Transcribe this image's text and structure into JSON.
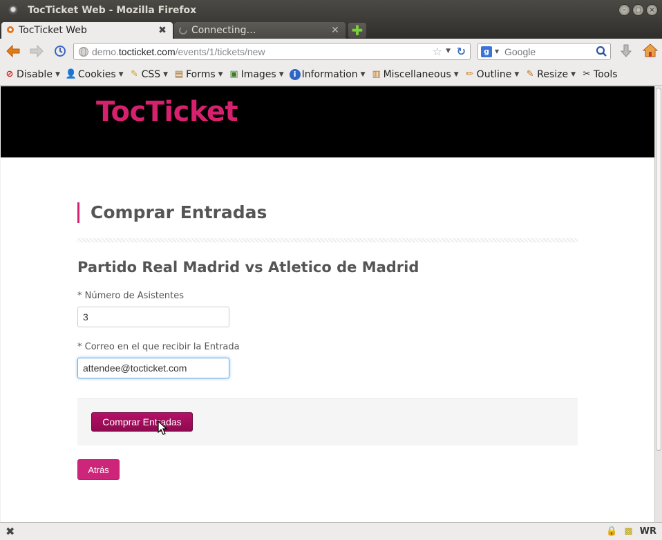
{
  "window": {
    "title": "TocTicket Web - Mozilla Firefox"
  },
  "tabs": [
    {
      "label": "TocTicket Web",
      "active": true
    },
    {
      "label": "Connecting…",
      "active": false
    }
  ],
  "address_bar": {
    "url_prefix": "demo.",
    "url_domain": "tocticket.com",
    "url_path": "/events/1/tickets/new"
  },
  "search_bar": {
    "placeholder": "Google"
  },
  "dev_toolbar": {
    "items": [
      {
        "label": "Disable",
        "icon": "disable-icon"
      },
      {
        "label": "Cookies",
        "icon": "cookies-icon"
      },
      {
        "label": "CSS",
        "icon": "css-icon"
      },
      {
        "label": "Forms",
        "icon": "forms-icon"
      },
      {
        "label": "Images",
        "icon": "images-icon"
      },
      {
        "label": "Information",
        "icon": "information-icon"
      },
      {
        "label": "Miscellaneous",
        "icon": "miscellaneous-icon"
      },
      {
        "label": "Outline",
        "icon": "outline-icon"
      },
      {
        "label": "Resize",
        "icon": "resize-icon"
      },
      {
        "label": "Tools",
        "icon": "tools-icon"
      }
    ]
  },
  "page": {
    "logo": "TocTicket",
    "title": "Comprar Entradas",
    "event_name": "Partido Real Madrid vs Atletico de Madrid",
    "attendees_label": "* Número de Asistentes",
    "attendees_value": "3",
    "email_label": "* Correo en el que recibir la Entrada",
    "email_value": "attendee@tocticket.com",
    "submit_label": "Comprar Entradas",
    "back_label": "Atrás"
  },
  "status_bar": {
    "indicator": "WR"
  },
  "colors": {
    "brand": "#d7206e",
    "primary_button": "#a30d5c",
    "header_bg": "#000000"
  }
}
